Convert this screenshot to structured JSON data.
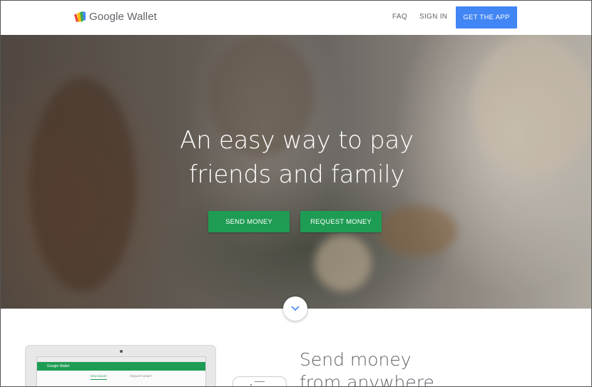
{
  "header": {
    "logo_text": "Google Wallet",
    "nav": [
      {
        "label": "FAQ"
      },
      {
        "label": "SIGN IN"
      }
    ],
    "cta_label": "GET THE APP"
  },
  "hero": {
    "title_line1": "An easy way to pay",
    "title_line2": "friends and family",
    "send_label": "SEND MONEY",
    "request_label": "REQUEST MONEY",
    "scroll_icon": "chevron-down-icon"
  },
  "section": {
    "title_line1": "Send money",
    "title_line2": "from anywhere",
    "screen_app_title": "Google Wallet",
    "screen_tab1": "SEND MONEY",
    "screen_tab2": "REQUEST MONEY"
  },
  "colors": {
    "accent_blue": "#4285f4",
    "accent_green": "#1e9c54",
    "text_gray": "#5f6368"
  }
}
